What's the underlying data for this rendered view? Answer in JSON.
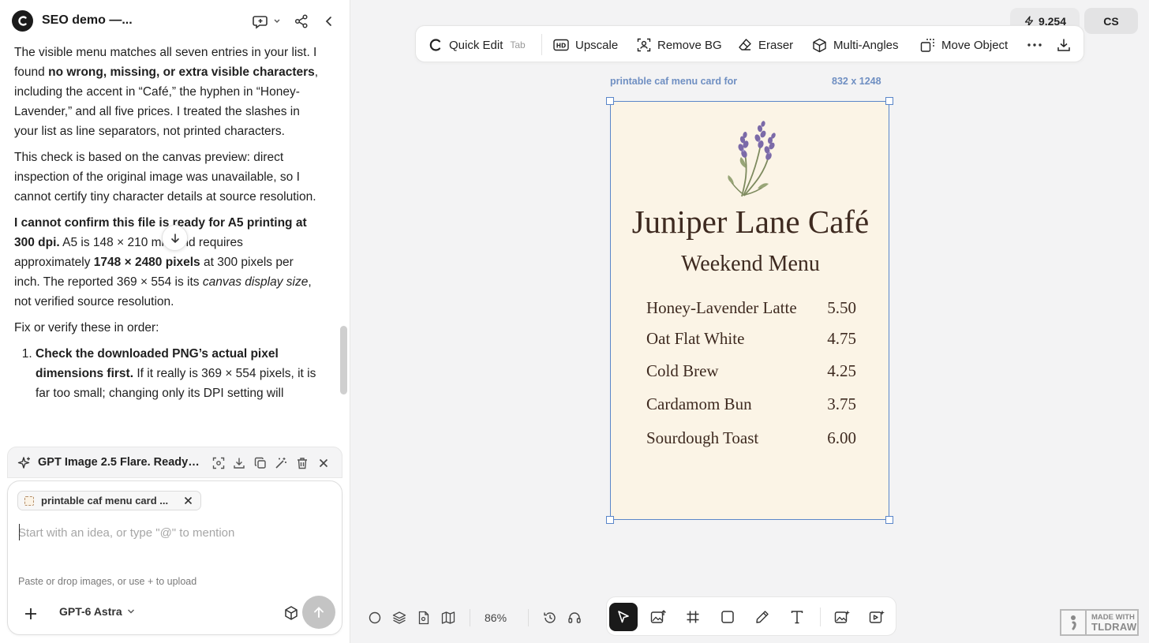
{
  "chat": {
    "title": "SEO demo —...",
    "messages": {
      "p1": {
        "t1": "The visible menu matches all seven entries in your list. I found ",
        "b1": "no wrong, missing, or extra visible characters",
        "t2": ", including the accent in “Café,” the hyphen in “Honey-Lavender,” and all five prices. I treated the slashes in your list as line separators, not printed characters."
      },
      "p2": "This check is based on the canvas preview: direct inspection of the original image was unavailable, so I cannot certify tiny character details at source resolution.",
      "p3": {
        "b1": "I cannot confirm this file is ready for A5 printing at 300 dpi.",
        "t1": " A5 is 148 × 210 mm and requires approximately ",
        "b2": "1748 × 2480 pixels",
        "t2": " at 300 pixels per inch. The reported 369 × 554 is its ",
        "i1": "canvas display size",
        "t3": ", not verified source resolution."
      },
      "p4": "Fix or verify these in order:",
      "list_item_1": {
        "b1": "Check the downloaded PNG’s actual pixel dimensions first.",
        "t1": " If it really is 369 × 554 pixels, it is far too small; changing only its DPI setting will"
      }
    },
    "generation": {
      "status": "GPT Image 2.5 Flare. Ready ..."
    },
    "composer": {
      "attachment_label": "printable caf menu card ...",
      "placeholder": "Start with an idea, or type \"@\" to mention",
      "upload_hint": "Paste or drop images, or use + to upload",
      "model": "GPT-6 Astra"
    }
  },
  "canvas": {
    "credits": "9.254",
    "user_initials": "CS",
    "toolbar": {
      "quick_edit": "Quick Edit",
      "quick_edit_shortcut": "Tab",
      "upscale": "Upscale",
      "remove_bg": "Remove BG",
      "eraser": "Eraser",
      "multi_angles": "Multi-Angles",
      "move_object": "Move Object"
    },
    "frame": {
      "label": "printable caf menu card for",
      "size": "832 x 1248"
    },
    "menu_card": {
      "cafe_name": "Juniper Lane Café",
      "subtitle": "Weekend Menu",
      "items": [
        {
          "name": "Honey-Lavender Latte",
          "price": "5.50"
        },
        {
          "name": "Oat Flat White",
          "price": "4.75"
        },
        {
          "name": "Cold Brew",
          "price": "4.25"
        },
        {
          "name": "Cardamom Bun",
          "price": "3.75"
        },
        {
          "name": "Sourdough Toast",
          "price": "6.00"
        }
      ]
    },
    "zoom": "86%",
    "badge": {
      "line1": "MADE WITH",
      "line2": "TLDRAW"
    }
  },
  "colors": {
    "selection": "#5a86c9",
    "card_background": "#fbf4e6",
    "card_text": "#3e2a20",
    "active_tool": "#1a1a1a"
  },
  "icons": [
    "logo-icon",
    "new-chat-icon",
    "share-icon",
    "collapse-icon",
    "arrow-down-icon",
    "sparkle-icon",
    "focus-icon",
    "download-icon",
    "copy-icon",
    "magic-wand-icon",
    "trash-icon",
    "close-icon",
    "plus-icon",
    "chevron-down-icon",
    "cube-icon",
    "send-arrow-icon",
    "bolt-icon",
    "quick-edit-icon",
    "hd-icon",
    "remove-bg-icon",
    "eraser-icon",
    "multi-angles-icon",
    "move-object-icon",
    "more-icon",
    "lavender-icon",
    "circle-icon",
    "layers-icon",
    "page-icon",
    "map-icon",
    "history-icon",
    "headset-icon",
    "select-icon",
    "image-upload-icon",
    "frame-icon",
    "rectangle-icon",
    "pencil-icon",
    "text-icon",
    "image-generate-icon",
    "video-generate-icon"
  ]
}
